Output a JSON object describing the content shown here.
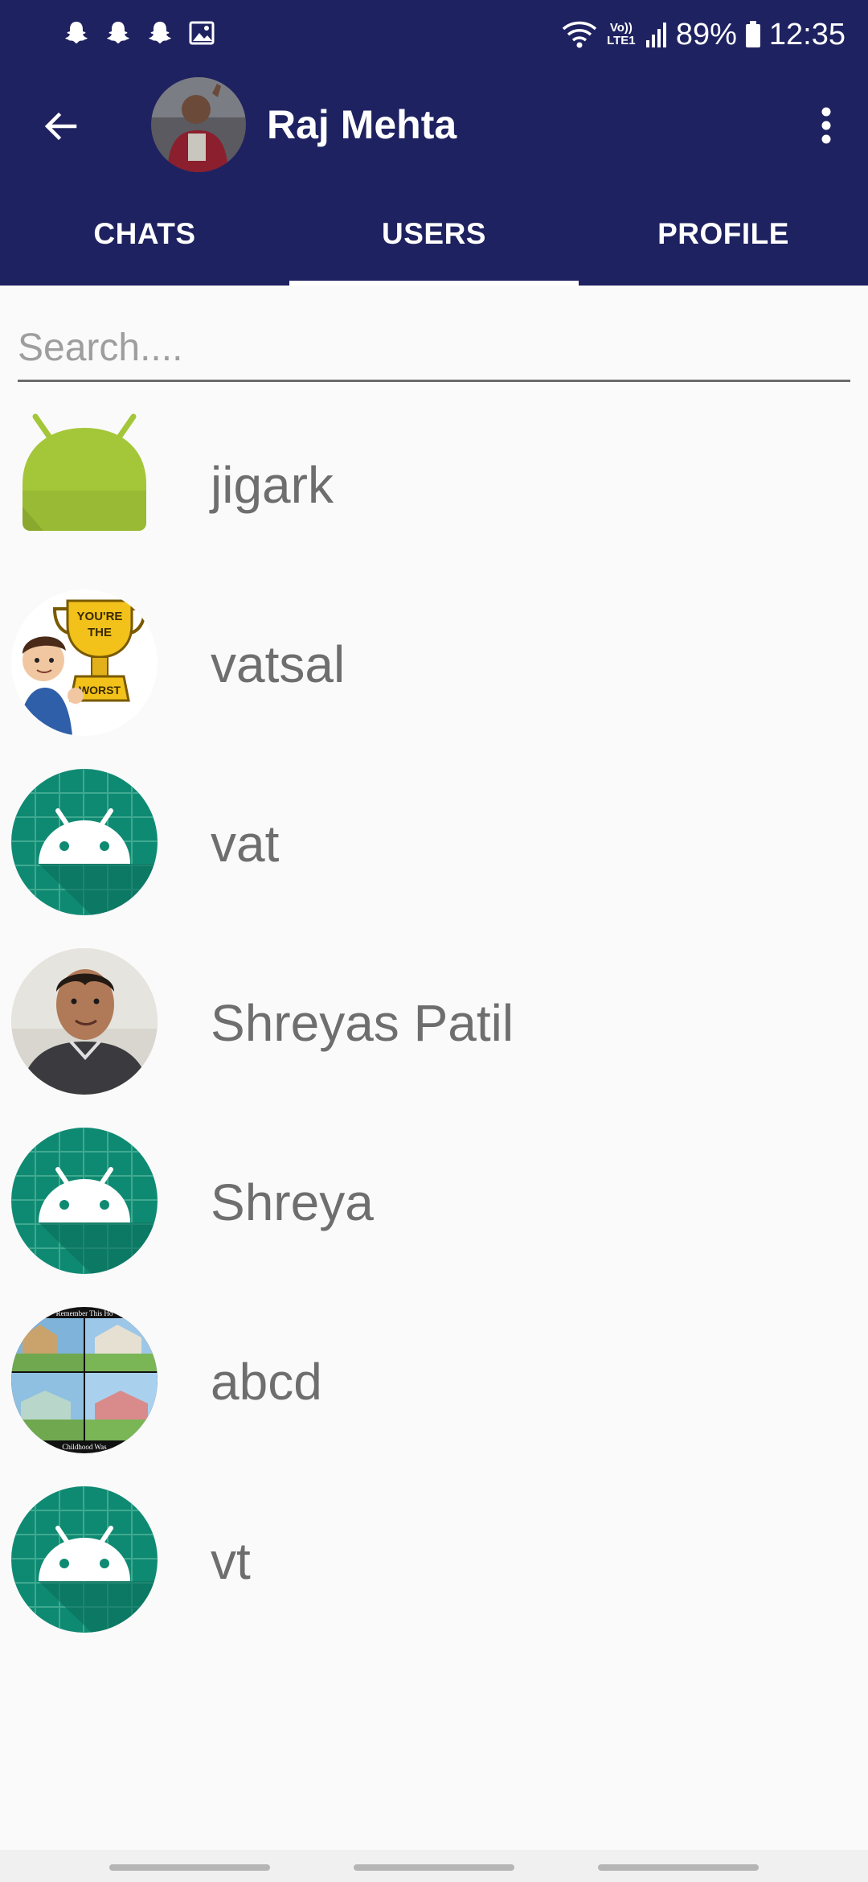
{
  "status_bar": {
    "network_label": "Vo)) LTE1",
    "battery": "89%",
    "time": "12:35"
  },
  "toolbar": {
    "title": "Raj Mehta"
  },
  "tabs": [
    {
      "label": "CHATS",
      "selected": false
    },
    {
      "label": "USERS",
      "selected": true
    },
    {
      "label": "PROFILE",
      "selected": false
    }
  ],
  "search": {
    "placeholder": "Search....",
    "value": ""
  },
  "users": [
    {
      "name": "jigark",
      "avatar": "android-robot-icon"
    },
    {
      "name": "vatsal",
      "avatar": "bitmoji-trophy-avatar"
    },
    {
      "name": "vat",
      "avatar": "android-default-avatar"
    },
    {
      "name": "Shreyas Patil",
      "avatar": "photo-avatar"
    },
    {
      "name": "Shreya",
      "avatar": "android-default-avatar"
    },
    {
      "name": "abcd",
      "avatar": "houses-collage-avatar"
    },
    {
      "name": "vt",
      "avatar": "android-default-avatar"
    }
  ],
  "colors": {
    "app_bar": "#1f2260",
    "accent": "#ffffff",
    "android_green": "#a4c639",
    "teal": "#0f8a72"
  }
}
